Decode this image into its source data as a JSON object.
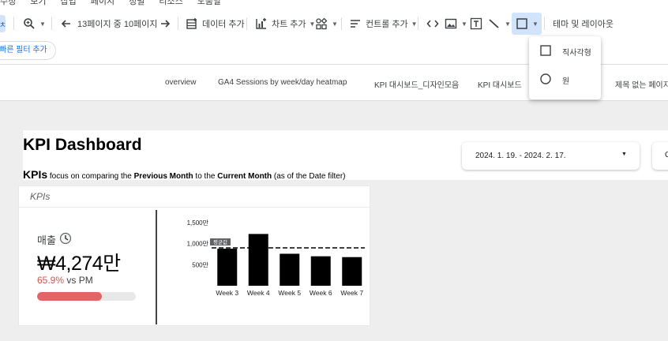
{
  "menubar": [
    "수정",
    "보기",
    "삽입",
    "페이지",
    "정렬",
    "리소스",
    "도움말"
  ],
  "toolbar": {
    "first_btn_label": "ㅊ",
    "page_nav": "13페이지 중 10페이지",
    "add_data": "데이터 추가",
    "add_chart": "차트 추가",
    "add_control": "컨트롤 추가",
    "theme_layout": "테마 및 레이아웃"
  },
  "filter": {
    "quick_filter": "빠른 필터 추가"
  },
  "page_tabs": [
    "overview",
    "GA4 Sessions by week/day heatmap",
    "KPI 대시보드_디자인모음",
    "KPI 대시보드",
    "제목 없는 페이지"
  ],
  "shape_menu": {
    "items": [
      "직사각형",
      "원"
    ]
  },
  "report": {
    "title": "KPI Dashboard",
    "subtitle": {
      "kpis": "KPIs",
      "t1": " focus on comparing the ",
      "prev": "Previous Month",
      "t2": " to the ",
      "curr": "Current Month",
      "t3": " (as of the Date filter)"
    },
    "date_range": "2024. 1. 19. - 2024. 2. 17.",
    "date_card2": "C",
    "kpi_card": {
      "header": "KPIs",
      "metric_label": "매출",
      "metric_value": "₩4,274만",
      "change_pct": "65.9%",
      "change_suffix": " vs PM",
      "progress": 0.659,
      "progress_color": "#e06666"
    }
  },
  "chart_data": {
    "type": "bar",
    "categories": [
      "Week 3",
      "Week 4",
      "Week 5",
      "Week 6",
      "Week 7"
    ],
    "values": [
      880,
      1230,
      760,
      700,
      680
    ],
    "average": 900,
    "average_label": "평균값",
    "ytick_labels": [
      "1,500만",
      "1,000만",
      "500만"
    ],
    "yticks": [
      1500,
      1000,
      500
    ],
    "ylim": [
      0,
      1500
    ]
  }
}
